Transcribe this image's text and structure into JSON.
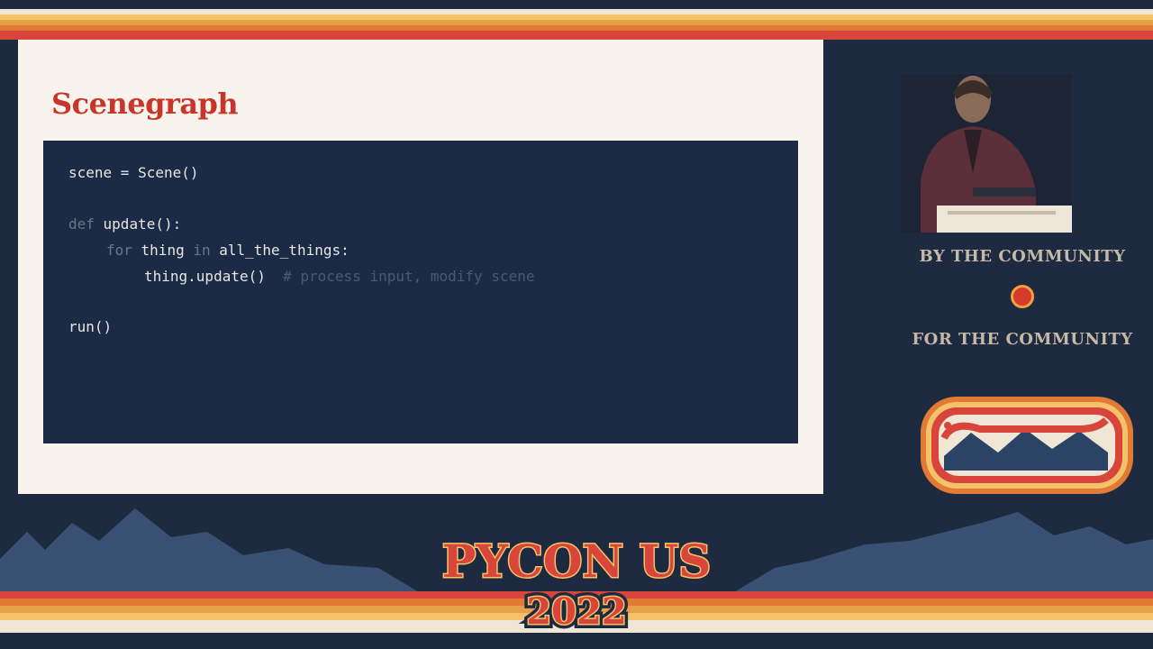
{
  "slide": {
    "title": "Scenegraph",
    "code": {
      "line1": "scene = Scene()",
      "line2_kw": "def",
      "line2_rest": " update():",
      "line3_kw1": "for",
      "line3_mid": " thing ",
      "line3_kw2": "in",
      "line3_rest": " all_the_things:",
      "line4_code": "thing.update()",
      "line4_comment": "  # process input, modify scene",
      "line5": "run()"
    }
  },
  "sidebar": {
    "tagline_top": "BY THE COMMUNITY",
    "tagline_bottom": "FOR THE COMMUNITY"
  },
  "footer": {
    "event_name": "PYCON US",
    "event_year": "2022"
  },
  "colors": {
    "background": "#1d2a40",
    "accent_red": "#c8362b",
    "accent_orange": "#e08a3a",
    "slide_bg": "#f8f3ec",
    "code_bg": "#1b2a45"
  }
}
